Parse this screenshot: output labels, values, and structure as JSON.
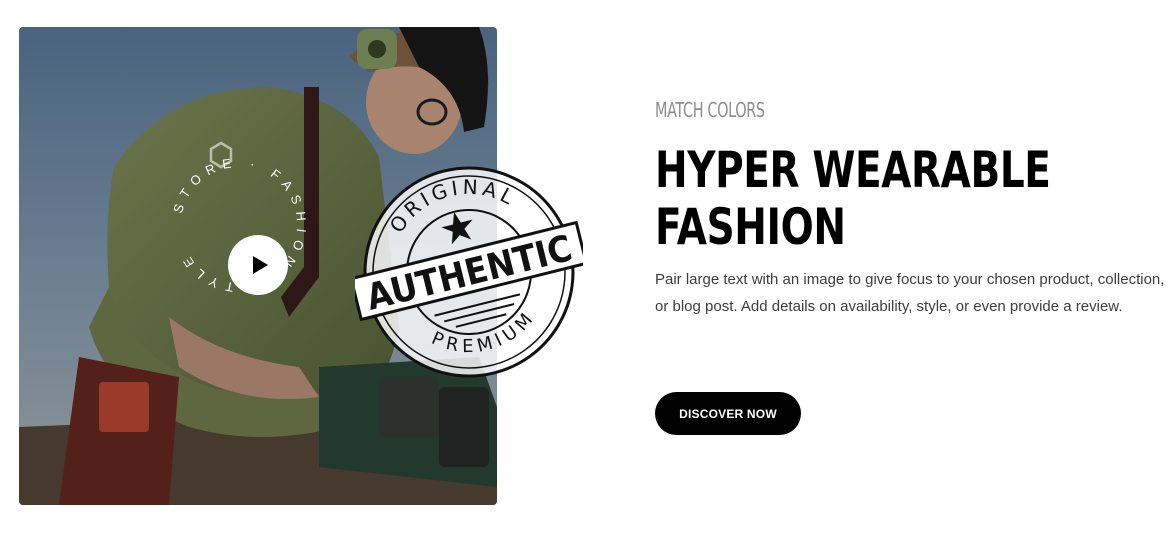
{
  "media": {
    "circle_text": "STORE  ·  FASHION  ·  STYLE",
    "stamp": {
      "top_text": "ORIGINAL",
      "center_text": "AUTHENTIC",
      "bottom_text": "PREMIUM"
    }
  },
  "content": {
    "subtitle": "MATCH COLORS",
    "title_line1": "HYPER WEARABLE",
    "title_line2": "FASHION",
    "description": "Pair large text with an image to give focus to your chosen product, collection, or blog post. Add details on availability, style, or even provide a review.",
    "button_label": "DISCOVER NOW"
  },
  "colors": {
    "button_bg": "#000000",
    "subtitle": "#8d8d8d",
    "title": "#000000",
    "body_text": "#3d3d3d"
  }
}
